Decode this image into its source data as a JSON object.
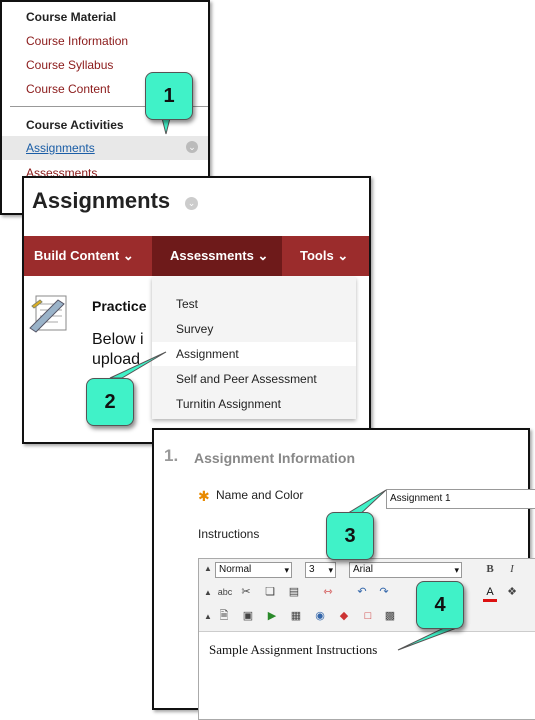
{
  "course_menu": {
    "section1": "Course Material",
    "links": [
      "Course Information",
      "Course Syllabus",
      "Course Content"
    ],
    "section2": "Course Activities",
    "active_link": "Assignments",
    "link_after": "Assessments"
  },
  "assignments": {
    "title": "Assignments",
    "tabs": [
      "Build Content",
      "Assessments",
      "Tools"
    ],
    "item_title": "Practice",
    "item_text_line1": "Below i",
    "item_text_line2": "upload",
    "menu_items": [
      "Test",
      "Survey",
      "Assignment",
      "Self and Peer Assessment",
      "Turnitin Assignment"
    ],
    "selected_item": "Assignment"
  },
  "assignment_form": {
    "step_number": "1.",
    "section_heading": "Assignment Information",
    "name_label": "Name and Color",
    "name_value": "Assignment 1",
    "instructions_label": "Instructions",
    "format_value": "Normal",
    "size_value": "3",
    "font_value": "Arial",
    "content_text": "Sample Assignment Instructions"
  },
  "callouts": [
    "1",
    "2",
    "3",
    "4"
  ],
  "colors": {
    "callout": "#40f2c8",
    "nav_bar": "#9b2c2c",
    "nav_active": "#6e1a1a",
    "link": "#8b1a1a",
    "required_star": "#e88a00"
  }
}
